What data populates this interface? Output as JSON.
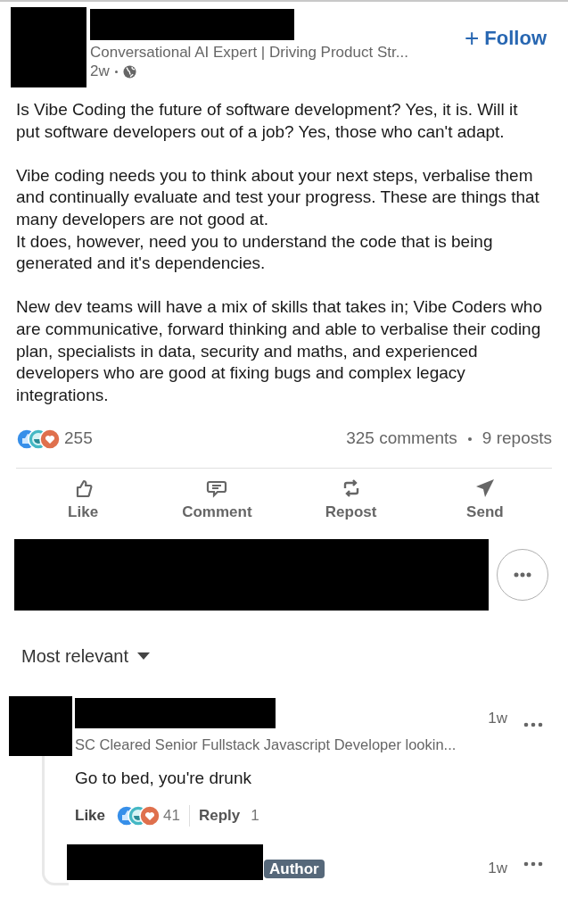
{
  "post": {
    "author_headline": "Conversational AI Expert | Driving Product Str...",
    "time": "2w",
    "follow_label": "Follow",
    "follow_glyph": "+",
    "body": [
      [
        "Is Vibe Coding the future of software development? Yes, it is. Will it put software developers out of a job? Yes, those who can't adapt."
      ],
      [
        "Vibe coding needs you to think about your next steps, verbalise them and continually evaluate and test your progress. These are things that many developers are not good at.",
        "It does, however, need you to understand the code that is being generated and it's dependencies."
      ],
      [
        "New dev teams will have a mix of skills that takes in; Vibe Coders who are communicative, forward thinking and able to verbalise their coding plan, specialists in data, security and maths, and experienced developers who are good at fixing bugs and complex legacy integrations."
      ]
    ],
    "reaction_count": "255",
    "comments": "325 comments",
    "reposts": "9 reposts",
    "actions": [
      {
        "kind": "like",
        "label": "Like"
      },
      {
        "kind": "comment",
        "label": "Comment"
      },
      {
        "kind": "repost",
        "label": "Repost"
      },
      {
        "kind": "send",
        "label": "Send"
      }
    ]
  },
  "sort": {
    "label": "Most relevant"
  },
  "comment": {
    "headline": "SC Cleared Senior Fullstack Javascript Developer lookin...",
    "time": "1w",
    "text": "Go to bed, you're drunk",
    "like_label": "Like",
    "reaction_count": "41",
    "reply_label": "Reply",
    "reply_count": "1"
  },
  "reply": {
    "badge": "Author",
    "time": "1w"
  }
}
